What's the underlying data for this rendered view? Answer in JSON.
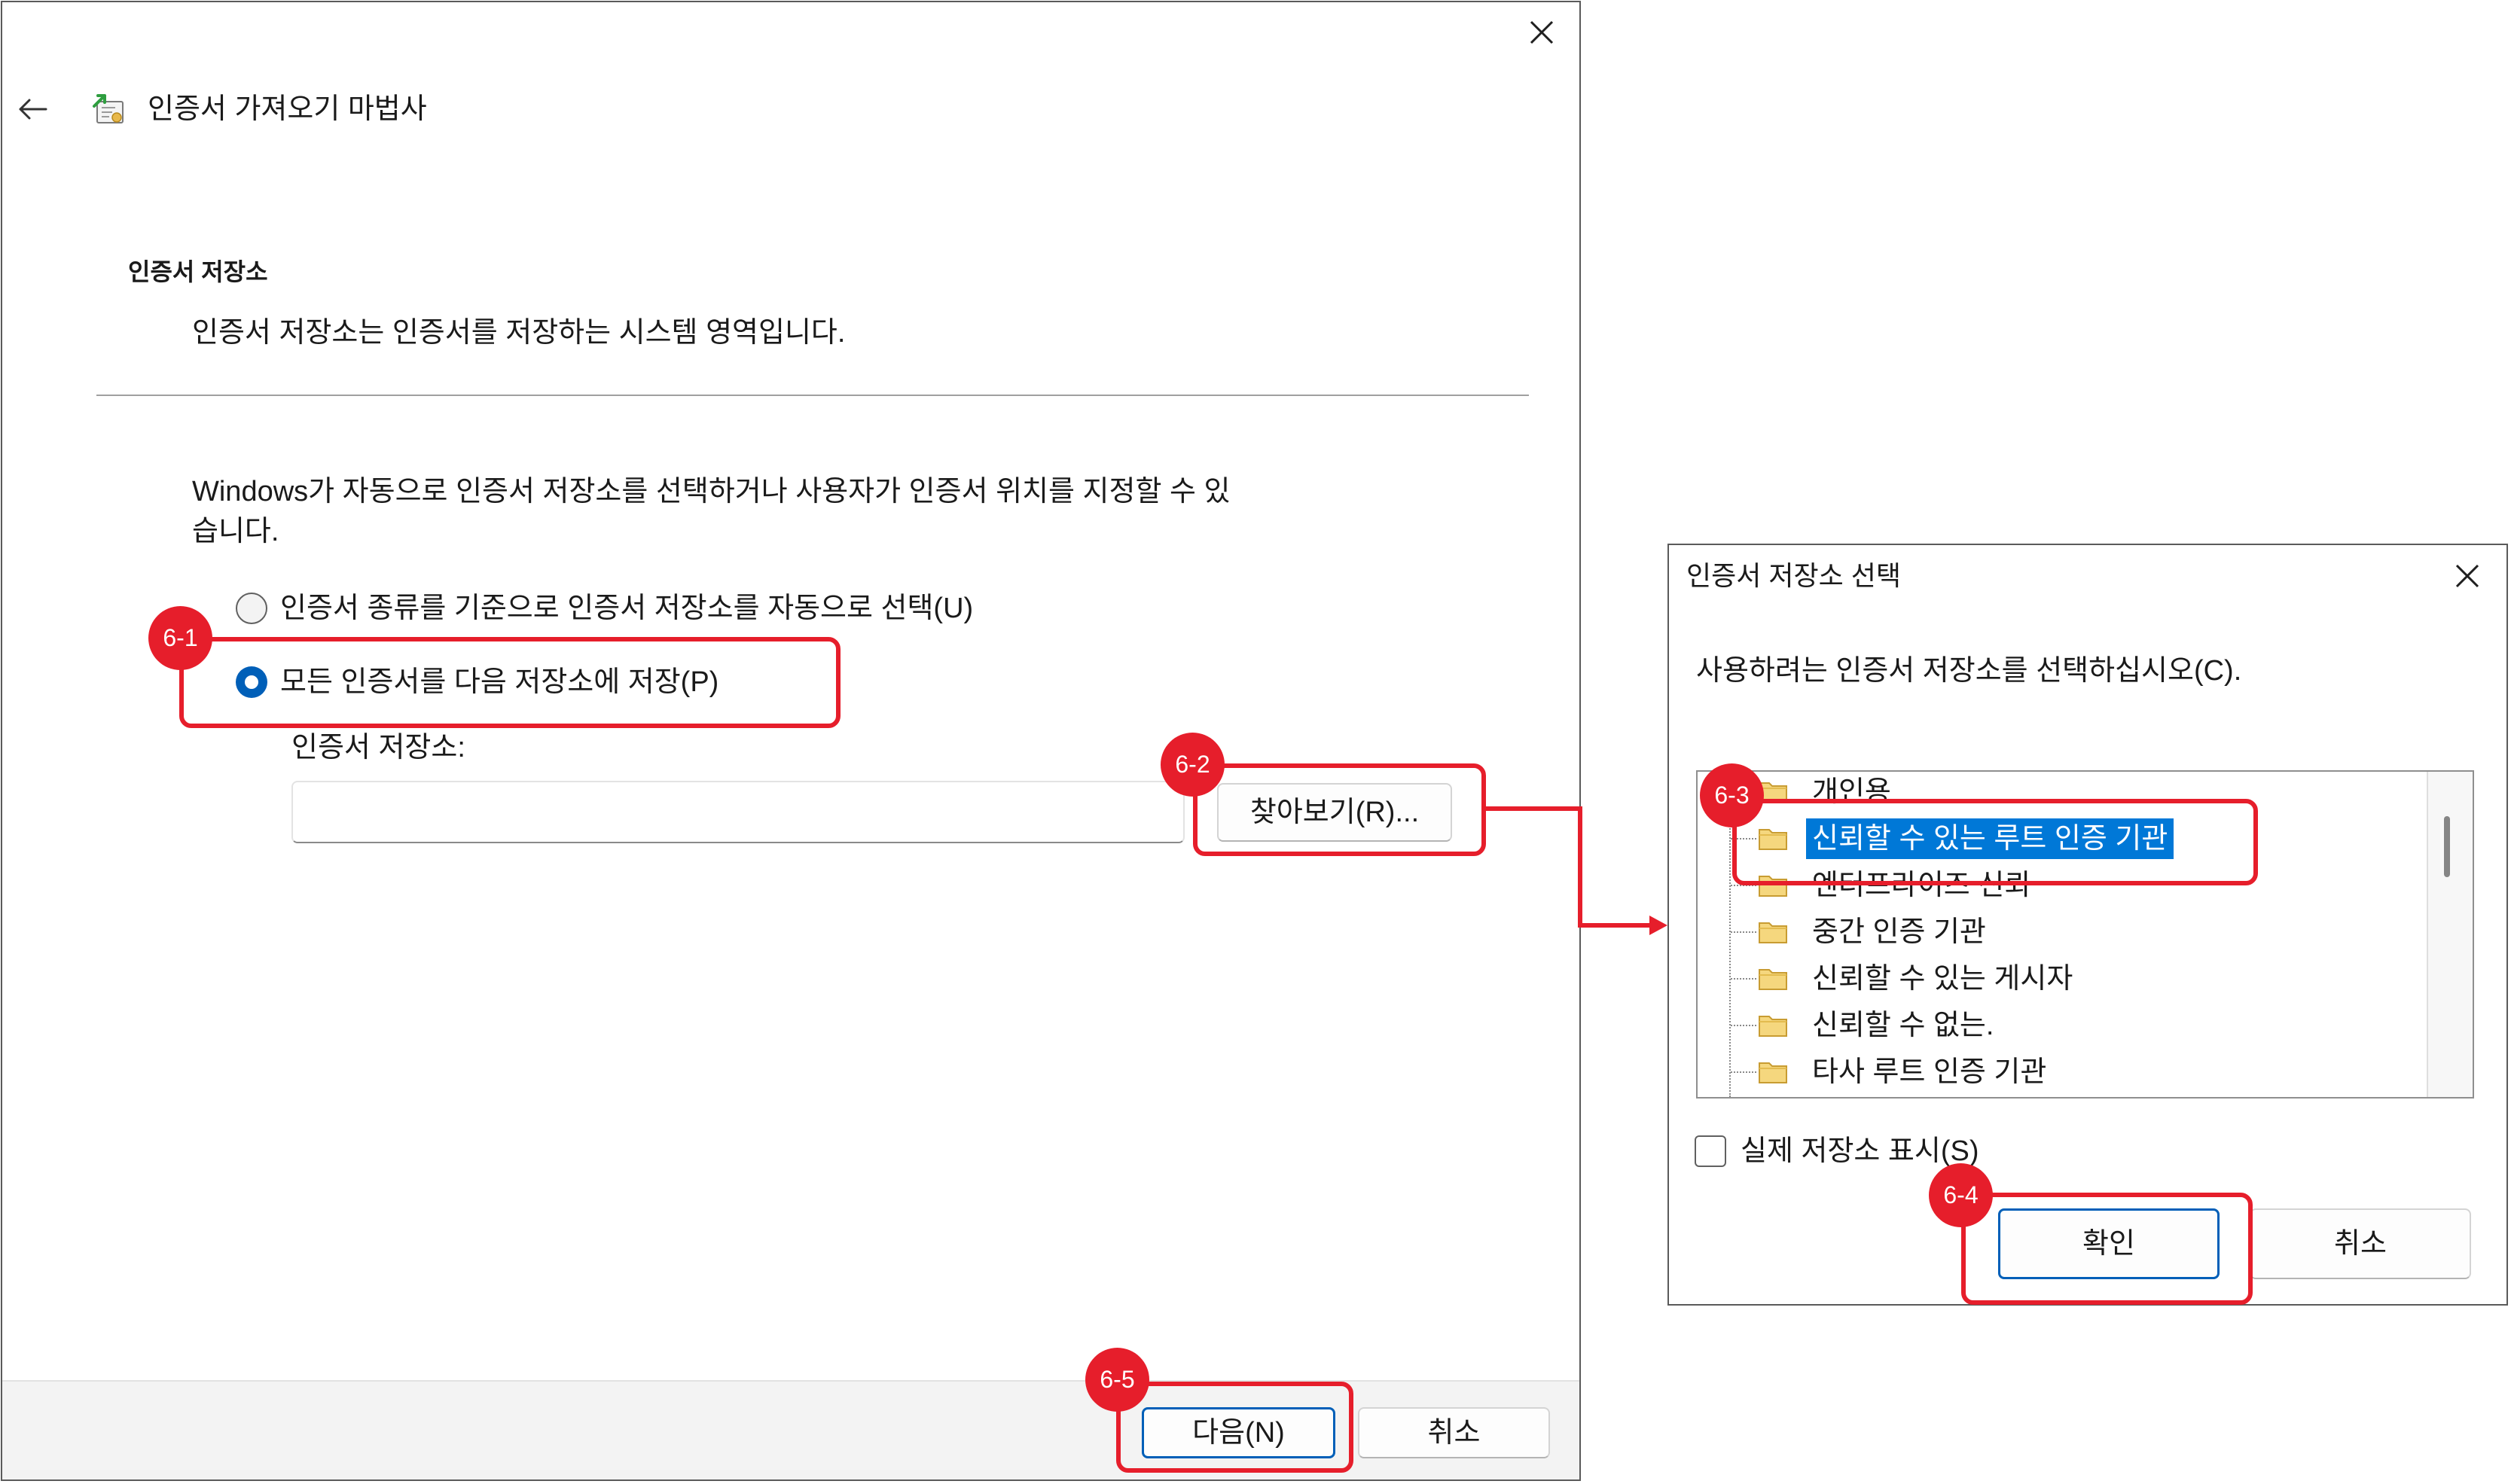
{
  "wizard": {
    "title": "인증서 가져오기 마법사",
    "section_heading": "인증서 저장소",
    "section_description": "인증서 저장소는 인증서를 저장하는 시스템 영역입니다.",
    "intro_lines": [
      "Windows가 자동으로 인증서 저장소를 선택하거나 사용자가 인증서 위치를 지정할 수 있",
      "습니다."
    ],
    "options": [
      {
        "label": "인증서 종류를 기준으로 인증서 저장소를 자동으로 선택(U)",
        "selected": false
      },
      {
        "label": "모든 인증서를 다음 저장소에 저장(P)",
        "selected": true
      }
    ],
    "store_label": "인증서 저장소:",
    "store_value": "",
    "browse_label": "찾아보기(R)...",
    "next_label": "다음(N)",
    "cancel_label": "취소"
  },
  "store_dialog": {
    "title": "인증서 저장소 선택",
    "prompt": "사용하려는 인증서 저장소를 선택하십시오(C).",
    "stores": [
      "개인용",
      "신뢰할 수 있는 루트 인증 기관",
      "엔터프라이즈 신뢰",
      "중간 인증 기관",
      "신뢰할 수 있는 게시자",
      "신뢰할 수 없는.",
      "타사 루트 인증 기관"
    ],
    "selected_index": 1,
    "show_physical_label": "실제 저장소 표시(S)",
    "show_physical_checked": false,
    "ok_label": "확인",
    "cancel_label": "취소"
  },
  "annotations": {
    "steps": [
      "6-1",
      "6-2",
      "6-3",
      "6-4",
      "6-5"
    ]
  },
  "icons": {
    "wizard_close": "close-icon",
    "wizard_back": "back-arrow-icon",
    "wizard_logo": "certificate-wizard-icon",
    "tree_item": "folder-icon",
    "dialog_close": "close-icon"
  },
  "colors": {
    "accent": "#005fb8",
    "selection": "#0078d7",
    "annotation": "#e61e2b"
  }
}
